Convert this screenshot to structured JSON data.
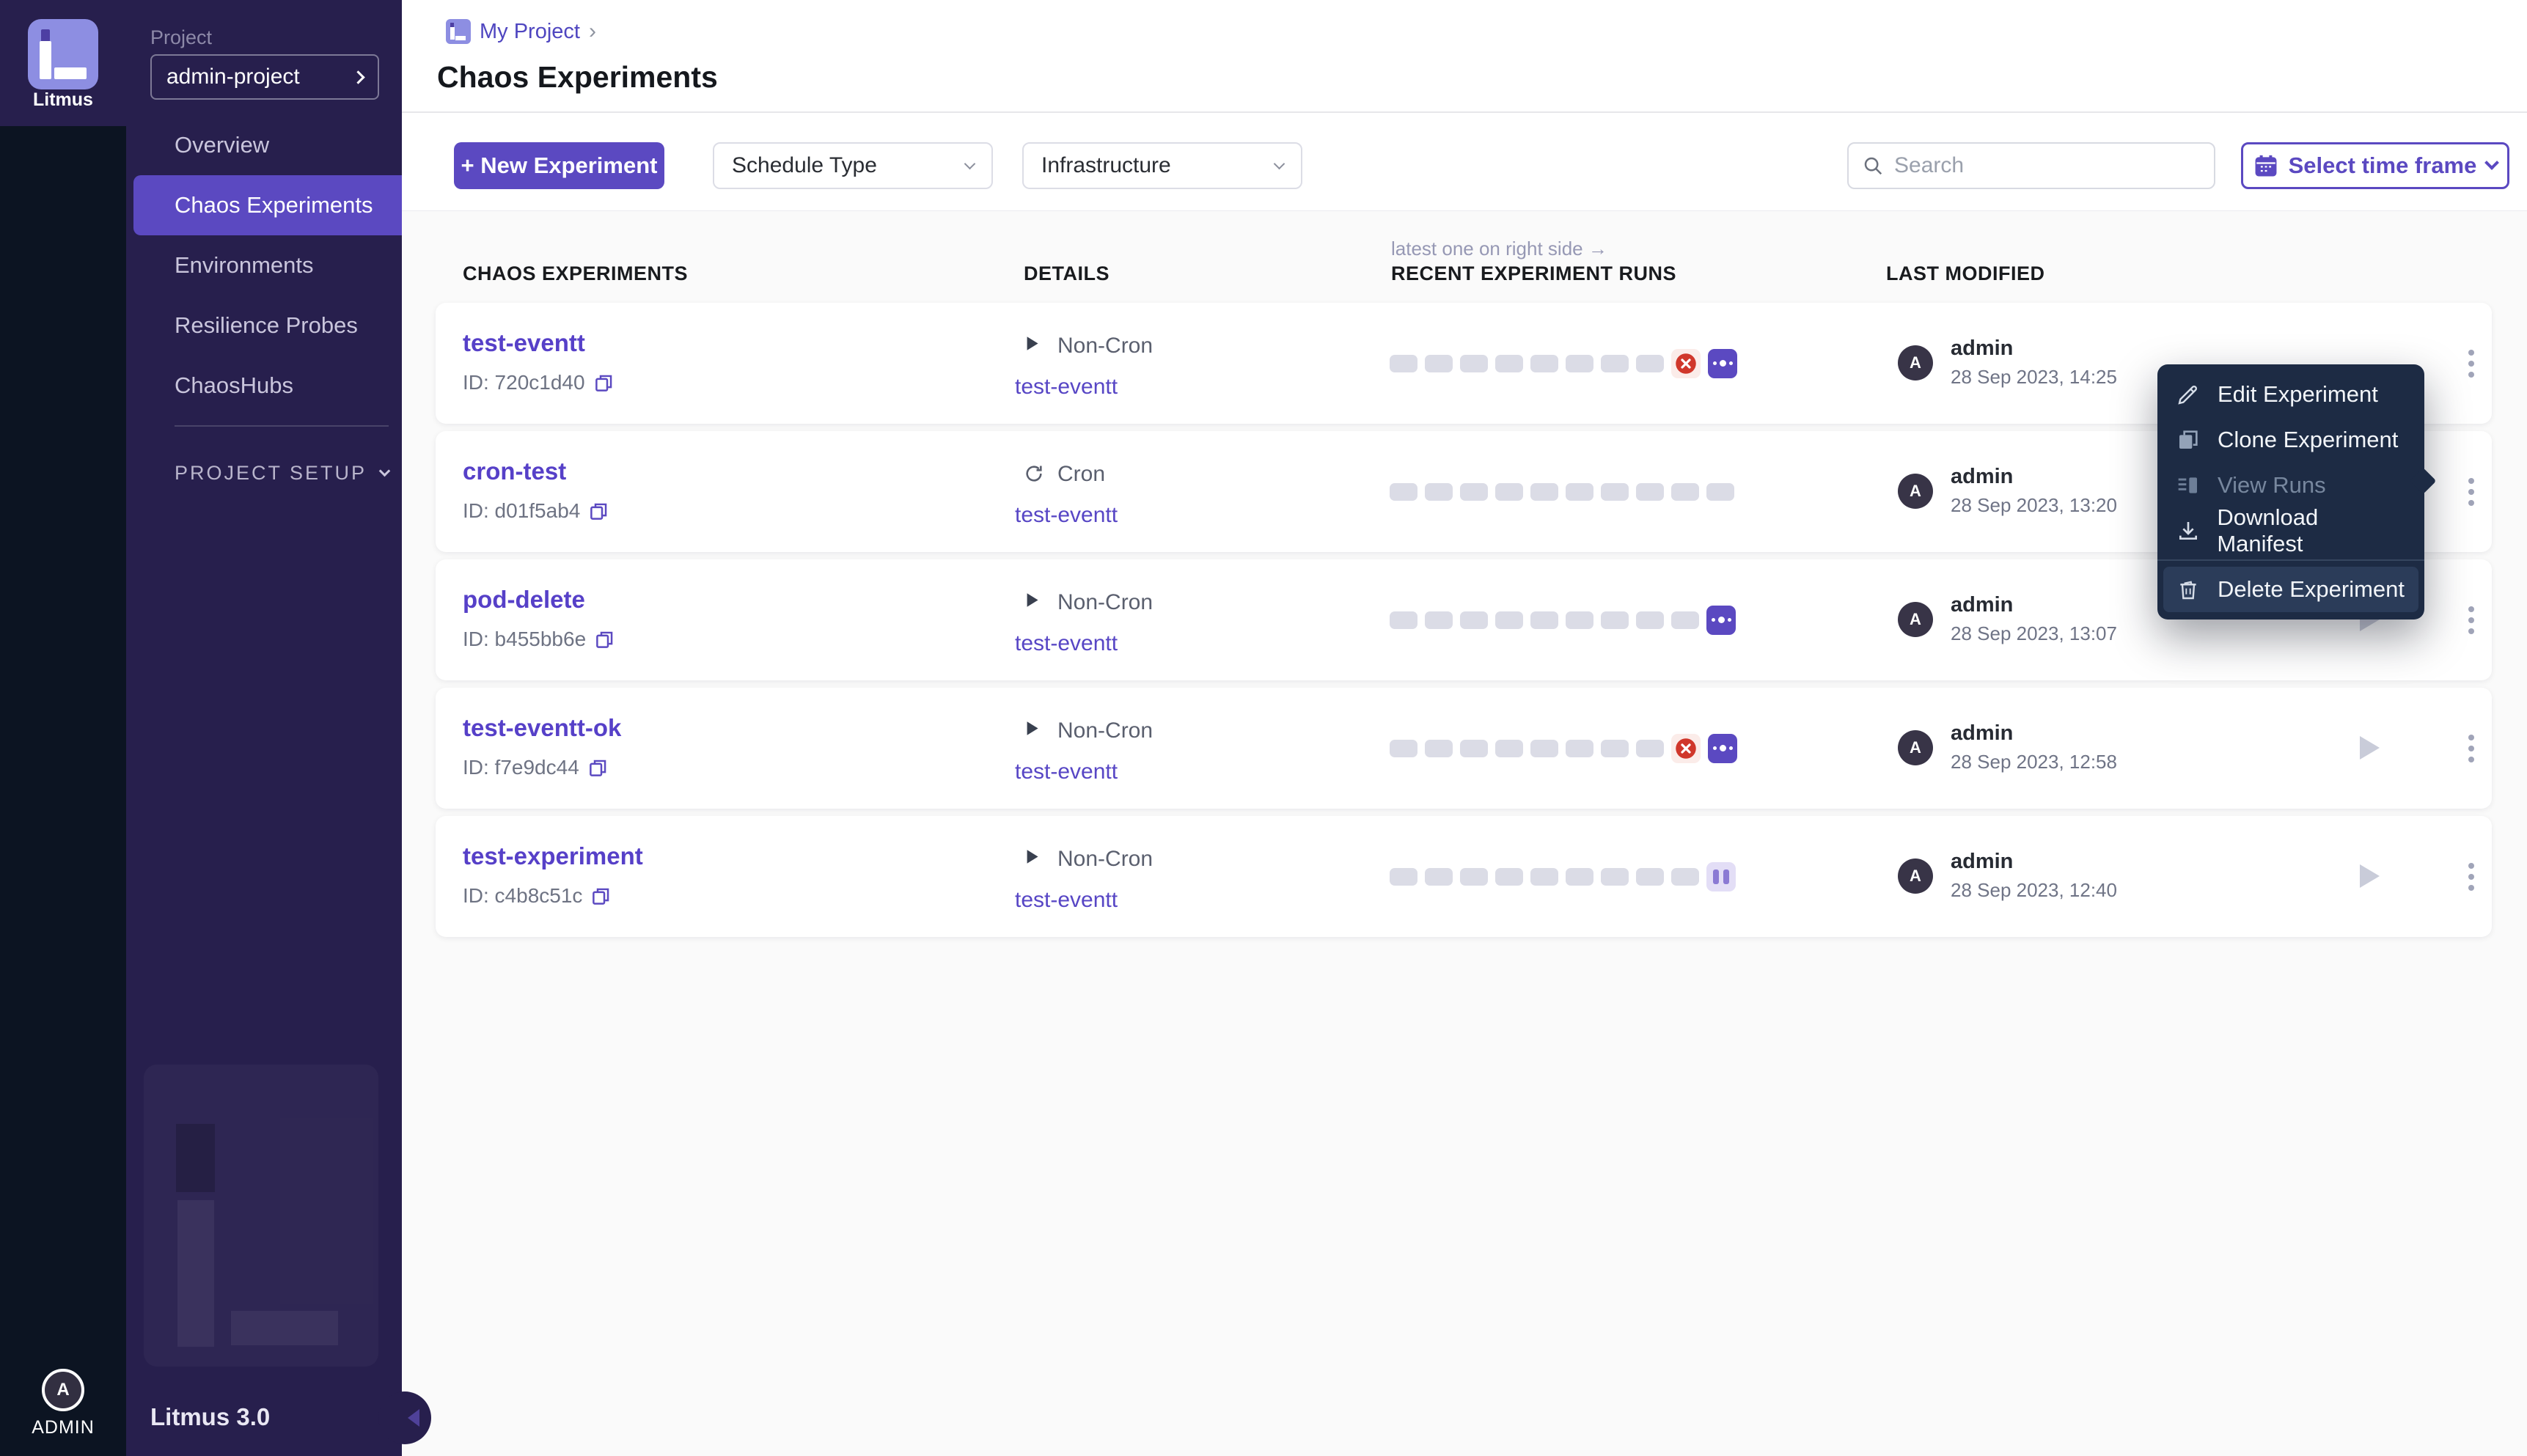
{
  "sidebar": {
    "brand": "Litmus",
    "project_label": "Project",
    "project_value": "admin-project",
    "nav": [
      {
        "label": "Overview",
        "active": false
      },
      {
        "label": "Chaos Experiments",
        "active": true
      },
      {
        "label": "Environments",
        "active": false
      },
      {
        "label": "Resilience Probes",
        "active": false
      },
      {
        "label": "ChaosHubs",
        "active": false
      }
    ],
    "section_label": "PROJECT SETUP",
    "version": "Litmus 3.0",
    "user_initial": "A",
    "user_label": "ADMIN"
  },
  "header": {
    "breadcrumb": "My Project",
    "breadcrumb_sep": "›",
    "title": "Chaos Experiments"
  },
  "toolbar": {
    "new_experiment": "+ New Experiment",
    "schedule_type": "Schedule Type",
    "infrastructure": "Infrastructure",
    "search_placeholder": "Search",
    "time_frame": "Select time frame"
  },
  "table": {
    "runs_note": "latest one on right side →",
    "columns": [
      "CHAOS EXPERIMENTS",
      "DETAILS",
      "RECENT EXPERIMENT RUNS",
      "LAST MODIFIED"
    ],
    "rows": [
      {
        "name": "test-eventt",
        "id": "ID: 720c1d40",
        "schedule": "Non-Cron",
        "cron": false,
        "infra": "test-eventt",
        "runs": [
          "e",
          "e",
          "e",
          "e",
          "e",
          "e",
          "e",
          "e",
          "f",
          "r"
        ],
        "owner": "admin",
        "modified": "28 Sep 2023, 14:25",
        "play": false
      },
      {
        "name": "cron-test",
        "id": "ID: d01f5ab4",
        "schedule": "Cron",
        "cron": true,
        "infra": "test-eventt",
        "runs": [
          "e",
          "e",
          "e",
          "e",
          "e",
          "e",
          "e",
          "e",
          "e",
          "e"
        ],
        "owner": "admin",
        "modified": "28 Sep 2023, 13:20",
        "play": false
      },
      {
        "name": "pod-delete",
        "id": "ID: b455bb6e",
        "schedule": "Non-Cron",
        "cron": false,
        "infra": "test-eventt",
        "runs": [
          "e",
          "e",
          "e",
          "e",
          "e",
          "e",
          "e",
          "e",
          "e",
          "r"
        ],
        "owner": "admin",
        "modified": "28 Sep 2023, 13:07",
        "play": true
      },
      {
        "name": "test-eventt-ok",
        "id": "ID: f7e9dc44",
        "schedule": "Non-Cron",
        "cron": false,
        "infra": "test-eventt",
        "runs": [
          "e",
          "e",
          "e",
          "e",
          "e",
          "e",
          "e",
          "e",
          "f",
          "r"
        ],
        "owner": "admin",
        "modified": "28 Sep 2023, 12:58",
        "play": true
      },
      {
        "name": "test-experiment",
        "id": "ID: c4b8c51c",
        "schedule": "Non-Cron",
        "cron": false,
        "infra": "test-eventt",
        "runs": [
          "e",
          "e",
          "e",
          "e",
          "e",
          "e",
          "e",
          "e",
          "e",
          "p"
        ],
        "owner": "admin",
        "modified": "28 Sep 2023, 12:40",
        "play": true
      }
    ]
  },
  "menu": {
    "items": [
      {
        "label": "Edit Experiment",
        "icon": "edit",
        "disabled": false,
        "highlighted": false
      },
      {
        "label": "Clone Experiment",
        "icon": "clone",
        "disabled": false,
        "highlighted": false
      },
      {
        "label": "View Runs",
        "icon": "runs",
        "disabled": true,
        "highlighted": false
      },
      {
        "label": "Download Manifest",
        "icon": "download",
        "disabled": false,
        "highlighted": false
      },
      {
        "label": "Delete Experiment",
        "icon": "trash",
        "disabled": false,
        "highlighted": true
      }
    ]
  },
  "colors": {
    "accent": "#5b49c1",
    "sidebar": "#271f4d",
    "rail": "#0c1422",
    "failed": "#d0372b",
    "failed_bg": "#fbece9",
    "paused_bg": "#e3def6",
    "empty_run": "#dbdce6",
    "menu_bg": "#1d2b44"
  }
}
